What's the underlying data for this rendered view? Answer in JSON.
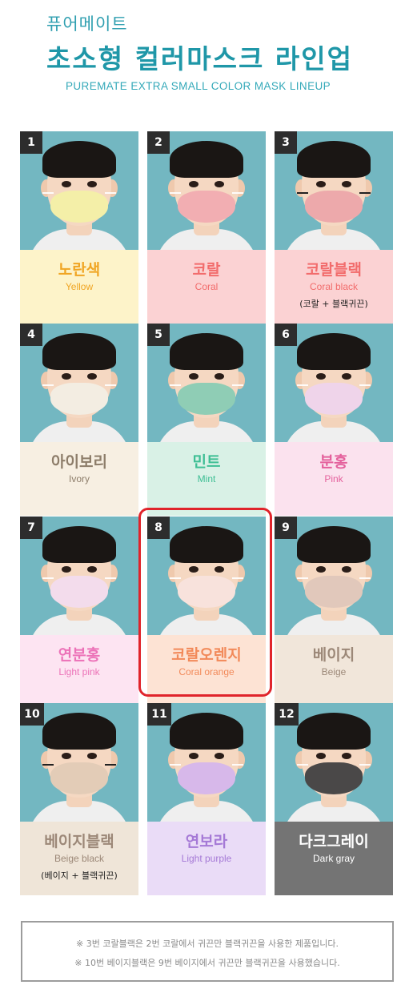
{
  "header": {
    "brand": "퓨어메이트",
    "title": "초소형 컬러마스크 라인업",
    "subtitle": "PUREMATE EXTRA SMALL COLOR MASK LINEUP"
  },
  "products": [
    {
      "number": "1",
      "name_ko": "노란색",
      "name_en": "Yellow",
      "note": "",
      "mask_color": "#f4efa8",
      "label_bg": "#fdf3c9",
      "name_ko_color": "#f0a523",
      "name_en_color": "#f0a523"
    },
    {
      "number": "2",
      "name_ko": "코랄",
      "name_en": "Coral",
      "note": "",
      "mask_color": "#f2aeb2",
      "label_bg": "#fbd2d3",
      "name_ko_color": "#f26c6c",
      "name_en_color": "#f26c6c"
    },
    {
      "number": "3",
      "name_ko": "코랄블랙",
      "name_en": "Coral black",
      "note": "(코랄 + 블랙귀끈)",
      "mask_color": "#eda9ab",
      "label_bg": "#fbd2d3",
      "name_ko_color": "#f26c6c",
      "name_en_color": "#f26c6c"
    },
    {
      "number": "4",
      "name_ko": "아이보리",
      "name_en": "Ivory",
      "note": "",
      "mask_color": "#f3ede2",
      "label_bg": "#f7efe2",
      "name_ko_color": "#8d7d6a",
      "name_en_color": "#8d7d6a"
    },
    {
      "number": "5",
      "name_ko": "민트",
      "name_en": "Mint",
      "note": "",
      "mask_color": "#8fcdb5",
      "label_bg": "#d9f1e6",
      "name_ko_color": "#3fbf95",
      "name_en_color": "#3fbf95"
    },
    {
      "number": "6",
      "name_ko": "분홍",
      "name_en": "Pink",
      "note": "",
      "mask_color": "#efd4ea",
      "label_bg": "#fbe2ee",
      "name_ko_color": "#e4609c",
      "name_en_color": "#e4609c"
    },
    {
      "number": "7",
      "name_ko": "연분홍",
      "name_en": "Light pink",
      "note": "",
      "mask_color": "#f3dcec",
      "label_bg": "#fde4f2",
      "name_ko_color": "#ec72b8",
      "name_en_color": "#ec72b8"
    },
    {
      "number": "8",
      "name_ko": "코랄오렌지",
      "name_en": "Coral orange",
      "note": "",
      "mask_color": "#f8e2dc",
      "label_bg": "#fde3d4",
      "name_ko_color": "#f28a5a",
      "name_en_color": "#f28a5a"
    },
    {
      "number": "9",
      "name_ko": "베이지",
      "name_en": "Beige",
      "note": "",
      "mask_color": "#e1c8bb",
      "label_bg": "#f1e6da",
      "name_ko_color": "#9c8878",
      "name_en_color": "#9c8878"
    },
    {
      "number": "10",
      "name_ko": "베이지블랙",
      "name_en": "Beige black",
      "note": "(베이지 + 블랙귀끈)",
      "mask_color": "#e3ccb7",
      "label_bg": "#efe5d8",
      "name_ko_color": "#9c8878",
      "name_en_color": "#9c8878"
    },
    {
      "number": "11",
      "name_ko": "연보라",
      "name_en": "Light purple",
      "note": "",
      "mask_color": "#d7b8ea",
      "label_bg": "#eadcf7",
      "name_ko_color": "#a579d6",
      "name_en_color": "#a579d6"
    },
    {
      "number": "12",
      "name_ko": "다크그레이",
      "name_en": "Dark gray",
      "note": "",
      "mask_color": "#4a4848",
      "label_bg": "#747474",
      "name_ko_color": "#ffffff",
      "name_en_color": "#ffffff"
    }
  ],
  "highlighted_number": "8",
  "notice": {
    "line1": "※ 3번 코랄블랙은 2번 코랄에서 귀끈만 블랙귀끈을 사용한 제품입니다.",
    "line2": "※ 10번 베이지블랙은 9번 베이지에서 귀끈만 블랙귀끈을 사용했습니다."
  }
}
